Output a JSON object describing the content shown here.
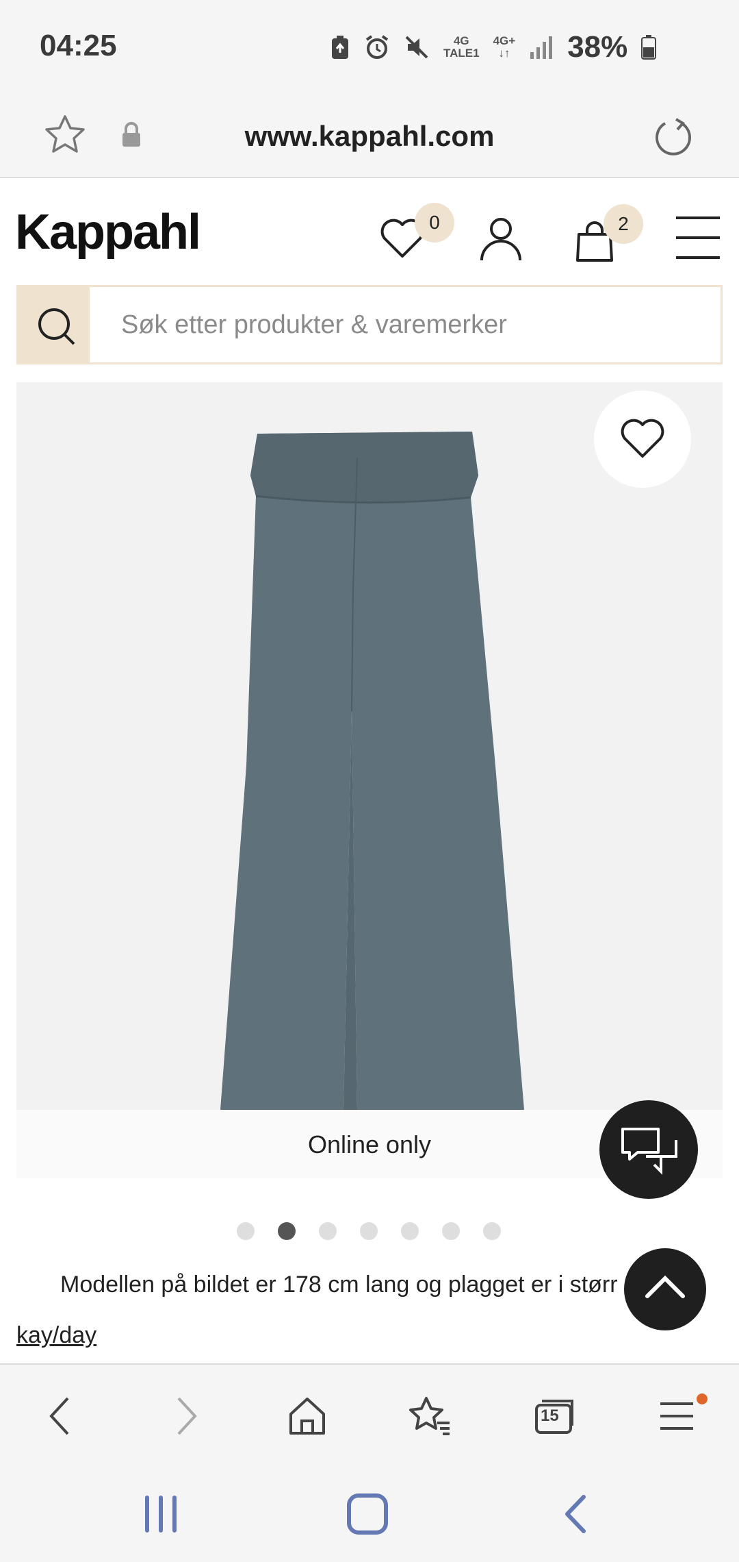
{
  "status_bar": {
    "time": "04:25",
    "network_1_top": "4G",
    "network_1_bottom": "TALE1",
    "network_2_top": "4G+",
    "network_2_bottom": "↓↑",
    "battery": "38%"
  },
  "browser": {
    "url": "www.kappahl.com"
  },
  "site": {
    "logo": "Kappahl",
    "wishlist_count": "0",
    "cart_count": "2"
  },
  "search": {
    "placeholder": "Søk etter produkter & varemerker"
  },
  "product": {
    "badge": "Online only",
    "image_count": 7,
    "active_image_index": 1,
    "model_info": "Modellen på bildet er 178 cm lang og plagget er i størr",
    "link": "kay/day",
    "colors": {
      "accent": "#efe3cf",
      "fabric": "#5f717a"
    }
  },
  "browser_nav": {
    "tabs_count": "15"
  }
}
